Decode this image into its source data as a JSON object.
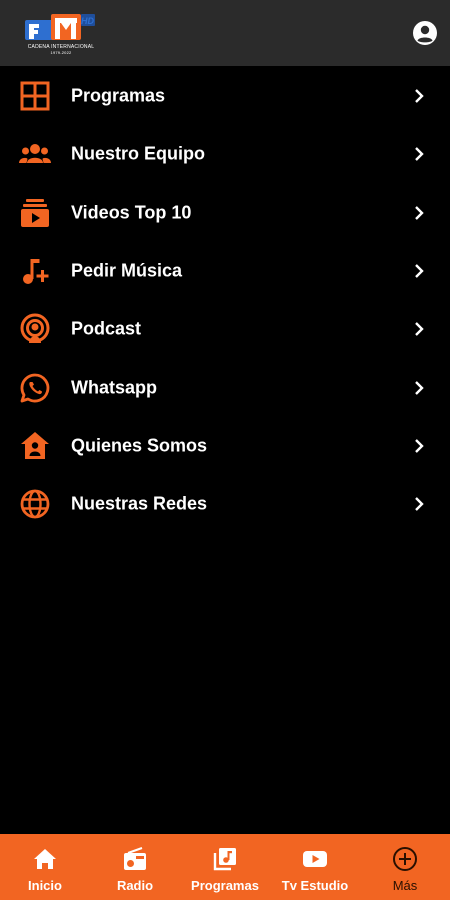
{
  "colors": {
    "accent": "#f26522",
    "topbar": "#2b2b2b",
    "background": "#000000",
    "text": "#ffffff"
  },
  "header": {
    "logo_badge": "HD",
    "logo_line1": "CADENA INTERNACIONAL",
    "logo_line2": "1979-2022",
    "account_icon": "account-circle-icon"
  },
  "menu": {
    "items": [
      {
        "label": "Programas",
        "icon": "grid-icon"
      },
      {
        "label": "Nuestro Equipo",
        "icon": "team-icon"
      },
      {
        "label": "Videos Top 10",
        "icon": "video-library-icon"
      },
      {
        "label": "Pedir Música",
        "icon": "music-add-icon"
      },
      {
        "label": "Podcast",
        "icon": "podcast-icon"
      },
      {
        "label": "Whatsapp",
        "icon": "whatsapp-icon"
      },
      {
        "label": "Quienes Somos",
        "icon": "house-user-icon"
      },
      {
        "label": "Nuestras Redes",
        "icon": "globe-icon"
      }
    ]
  },
  "bottom_nav": {
    "tabs": [
      {
        "label": "Inicio",
        "icon": "home-icon"
      },
      {
        "label": "Radio",
        "icon": "radio-icon"
      },
      {
        "label": "Programas",
        "icon": "music-library-icon"
      },
      {
        "label": "Tv Estudio",
        "icon": "youtube-icon"
      },
      {
        "label": "Más",
        "icon": "add-circle-icon",
        "active": true
      }
    ]
  }
}
